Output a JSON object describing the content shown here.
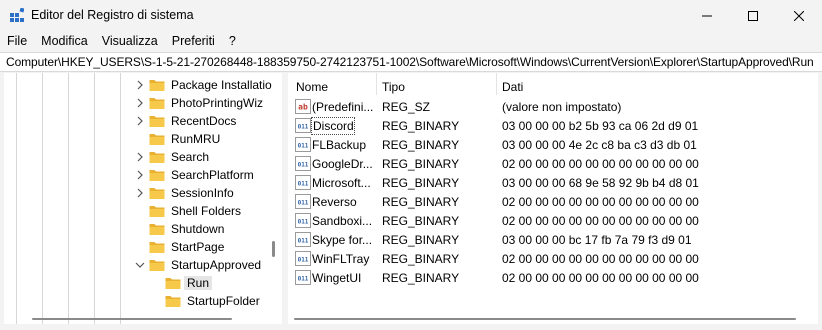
{
  "window": {
    "title": "Editor del Registro di sistema"
  },
  "menu": [
    "File",
    "Modifica",
    "Visualizza",
    "Preferiti",
    "?"
  ],
  "address": "Computer\\HKEY_USERS\\S-1-5-21-270268448-188359750-2742123751-1002\\Software\\Microsoft\\Windows\\CurrentVersion\\Explorer\\StartupApproved\\Run",
  "tree": [
    {
      "label": "Package Installatio",
      "expandable": true
    },
    {
      "label": "PhotoPrintingWiz",
      "expandable": true
    },
    {
      "label": "RecentDocs",
      "expandable": true
    },
    {
      "label": "RunMRU",
      "expandable": false
    },
    {
      "label": "Search",
      "expandable": true
    },
    {
      "label": "SearchPlatform",
      "expandable": true
    },
    {
      "label": "SessionInfo",
      "expandable": true
    },
    {
      "label": "Shell Folders",
      "expandable": false
    },
    {
      "label": "Shutdown",
      "expandable": false
    },
    {
      "label": "StartPage",
      "expandable": false
    },
    {
      "label": "StartupApproved",
      "expandable": true,
      "expanded": true
    },
    {
      "label": "Run",
      "expandable": false,
      "selected": true,
      "child": true
    },
    {
      "label": "StartupFolder",
      "expandable": false,
      "child": true
    }
  ],
  "columns": {
    "name": "Nome",
    "type": "Tipo",
    "data": "Dati"
  },
  "values": [
    {
      "name": "(Predefinito)",
      "type": "REG_SZ",
      "data": "(valore non impostato)",
      "icon": "string-value-icon"
    },
    {
      "name": "Discord",
      "type": "REG_BINARY",
      "data": "03 00 00 00 b2 5b 93 ca 06 2d d9 01",
      "icon": "binary-value-icon",
      "selected": true
    },
    {
      "name": "FLBackup",
      "type": "REG_BINARY",
      "data": "03 00 00 00 4e 2c c8 ba c3 d3 db 01",
      "icon": "binary-value-icon"
    },
    {
      "name": "GoogleDriveFS",
      "type": "REG_BINARY",
      "data": "02 00 00 00 00 00 00 00 00 00 00 00",
      "icon": "binary-value-icon"
    },
    {
      "name": "MicrosoftEdgeAutoLaunch",
      "type": "REG_BINARY",
      "data": "03 00 00 00 68 9e 58 92 9b b4 d8 01",
      "icon": "binary-value-icon"
    },
    {
      "name": "Reverso",
      "type": "REG_BINARY",
      "data": "02 00 00 00 00 00 00 00 00 00 00 00",
      "icon": "binary-value-icon"
    },
    {
      "name": "SandboxieControl",
      "type": "REG_BINARY",
      "data": "02 00 00 00 00 00 00 00 00 00 00 00",
      "icon": "binary-value-icon"
    },
    {
      "name": "Skype for Desktop",
      "type": "REG_BINARY",
      "data": "03 00 00 00 bc 17 fb 7a 79 f3 d9 01",
      "icon": "binary-value-icon"
    },
    {
      "name": "WinFLTray",
      "type": "REG_BINARY",
      "data": "02 00 00 00 00 00 00 00 00 00 00 00",
      "icon": "binary-value-icon"
    },
    {
      "name": "WingetUI",
      "type": "REG_BINARY",
      "data": "02 00 00 00 00 00 00 00 00 00 00 00",
      "icon": "binary-value-icon"
    }
  ],
  "colors": {
    "folder": "#f7c94a",
    "binary_icon": "#3466a8",
    "string_icon": "#c0392b"
  }
}
